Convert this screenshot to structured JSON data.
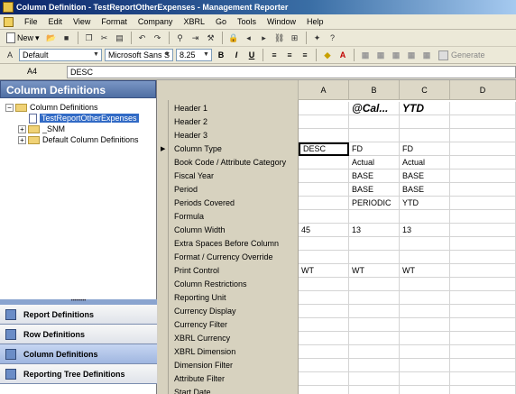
{
  "titlebar": {
    "title": "Column Definition - TestReportOtherExpenses - Management Reporter"
  },
  "menu": [
    "File",
    "Edit",
    "View",
    "Format",
    "Company",
    "XBRL",
    "Go",
    "Tools",
    "Window",
    "Help"
  ],
  "toolbar": {
    "new_label": "New"
  },
  "format_toolbar": {
    "style": "Default",
    "font": "Microsoft Sans S",
    "size": "8.25",
    "generate_label": "Generate"
  },
  "formula_bar": {
    "cell_ref": "A4",
    "value": "DESC"
  },
  "left_pane": {
    "header": "Column Definitions",
    "tree": {
      "root": "Column Definitions",
      "selected": "TestReportOtherExpenses",
      "folder1": "_SNM",
      "folder2": "Default Column Definitions"
    },
    "nav": [
      "Report Definitions",
      "Row Definitions",
      "Column Definitions",
      "Reporting Tree Definitions"
    ]
  },
  "grid": {
    "columns": [
      "A",
      "B",
      "C",
      "D"
    ],
    "rows": [
      {
        "label": "Header 1",
        "a": "",
        "b": "@Cal...",
        "c": "YTD"
      },
      {
        "label": "Header 2",
        "a": "",
        "b": "",
        "c": ""
      },
      {
        "label": "Header 3",
        "a": "",
        "b": "",
        "c": ""
      },
      {
        "label": "Column Type",
        "a": "DESC",
        "b": "FD",
        "c": "FD"
      },
      {
        "label": "Book Code / Attribute Category",
        "a": "",
        "b": "Actual",
        "c": "Actual"
      },
      {
        "label": "Fiscal Year",
        "a": "",
        "b": "BASE",
        "c": "BASE"
      },
      {
        "label": "Period",
        "a": "",
        "b": "BASE",
        "c": "BASE"
      },
      {
        "label": "Periods Covered",
        "a": "",
        "b": "PERIODIC",
        "c": "YTD"
      },
      {
        "label": "Formula",
        "a": "",
        "b": "",
        "c": ""
      },
      {
        "label": "Column Width",
        "a": "45",
        "b": "13",
        "c": "13"
      },
      {
        "label": "Extra Spaces Before Column",
        "a": "",
        "b": "",
        "c": ""
      },
      {
        "label": "Format / Currency Override",
        "a": "",
        "b": "",
        "c": ""
      },
      {
        "label": "Print Control",
        "a": "WT",
        "b": "WT",
        "c": "WT"
      },
      {
        "label": "Column Restrictions",
        "a": "",
        "b": "",
        "c": ""
      },
      {
        "label": "Reporting Unit",
        "a": "",
        "b": "",
        "c": ""
      },
      {
        "label": "Currency Display",
        "a": "",
        "b": "",
        "c": ""
      },
      {
        "label": "Currency Filter",
        "a": "",
        "b": "",
        "c": ""
      },
      {
        "label": "XBRL Currency",
        "a": "",
        "b": "",
        "c": ""
      },
      {
        "label": "XBRL Dimension",
        "a": "",
        "b": "",
        "c": ""
      },
      {
        "label": "Dimension Filter",
        "a": "",
        "b": "",
        "c": ""
      },
      {
        "label": "Attribute Filter",
        "a": "",
        "b": "",
        "c": ""
      },
      {
        "label": "Start Date",
        "a": "",
        "b": "",
        "c": ""
      }
    ]
  }
}
